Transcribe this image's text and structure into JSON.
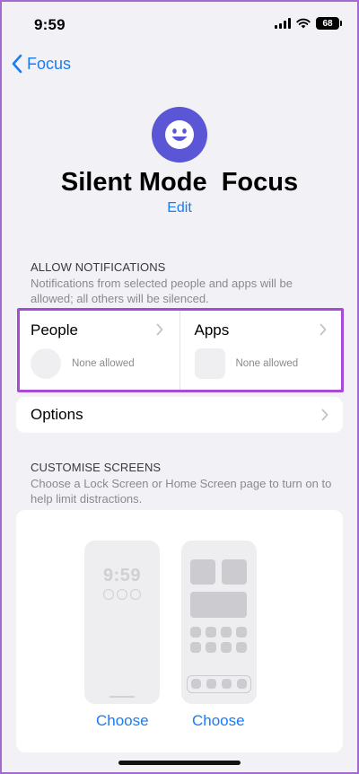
{
  "status_bar": {
    "time": "9:59",
    "battery": "68"
  },
  "nav": {
    "back_label": "Focus"
  },
  "header": {
    "title": "Silent Mode  Focus",
    "edit_label": "Edit"
  },
  "allow_notifications": {
    "section_title": "ALLOW NOTIFICATIONS",
    "description": "Notifications from selected people and apps will be allowed; all others will be silenced.",
    "people": {
      "label": "People",
      "status": "None allowed"
    },
    "apps": {
      "label": "Apps",
      "status": "None allowed"
    }
  },
  "options": {
    "label": "Options"
  },
  "customise_screens": {
    "section_title": "CUSTOMISE SCREENS",
    "description": "Choose a Lock Screen or Home Screen page to turn on to help limit distractions.",
    "lock_preview_time": "9:59",
    "lock_choose_label": "Choose",
    "home_choose_label": "Choose"
  },
  "colors": {
    "accent_blue": "#1a7cf5",
    "focus_icon_bg": "#5a56d6",
    "highlight_border": "#a64bd6",
    "background": "#f2f1f6"
  },
  "icons": {
    "back": "chevron-left-icon",
    "focus": "smiley-face-icon",
    "row_chevron": "chevron-right-icon"
  }
}
